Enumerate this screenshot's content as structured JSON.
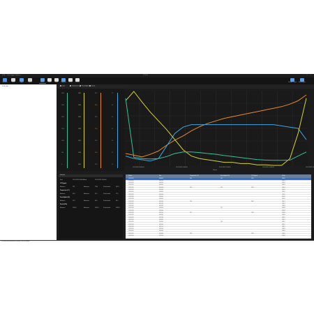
{
  "window": {
    "title": "PCE-... Data Logger Software",
    "center": "PCE-HT",
    "buttons": [
      "–",
      "□",
      "×"
    ]
  },
  "ribbon": {
    "left": [
      {
        "label": "Verbinden",
        "color": "#4a8fe0"
      },
      {
        "label": "Datei",
        "color": "#d8d8d8"
      },
      {
        "label": "Logger",
        "color": "#5aa0e8"
      },
      {
        "label": "Export",
        "color": "#cfcfcf"
      },
      {
        "label": "Ansicht",
        "color": "#5aa0e8",
        "active": true
      },
      {
        "label": "Zoom",
        "color": "#e0e0e0"
      },
      {
        "label": "Farbe",
        "color": "#e0e0e0"
      },
      {
        "label": "Diagramm",
        "color": "#5aa0e8"
      },
      {
        "label": "Tabelle",
        "color": "#e0e0e0"
      },
      {
        "label": "Drucken",
        "color": "#e0e0e0"
      }
    ],
    "right": [
      {
        "label": "Standard Layout",
        "color": "#5aa0e8"
      },
      {
        "label": "Einstellungen",
        "color": "#5aa0e8"
      }
    ]
  },
  "sidebar": {
    "item": "PCE-THD"
  },
  "tabs": [
    "Liste",
    "Temperatur",
    "Feuchtigkeit",
    "Druck"
  ],
  "colors": {
    "temperature": "#e88a2a",
    "humidity": "#3ea6e0",
    "pressure": "#d9d230",
    "dewpoint": "#35c29a",
    "selection": "#2f6fd6"
  },
  "yaxes": [
    {
      "color": "#35c29a",
      "ticks": [
        "3000",
        "2500",
        "2000",
        "1500",
        "1000",
        "500",
        "0"
      ]
    },
    {
      "color": "#d9d230",
      "ticks": [
        "1031",
        "1030",
        "1029",
        "1028",
        "1027",
        "1026",
        "1025"
      ]
    },
    {
      "color": "#e88a2a",
      "ticks": [
        "31,5",
        "30,0",
        "28,5",
        "27,0",
        "25,5",
        "24,0",
        "22,5"
      ]
    },
    {
      "color": "#3ea6e0",
      "ticks": [
        "75",
        "65",
        "55",
        "45",
        "35",
        "25",
        "15"
      ]
    }
  ],
  "chart_data": {
    "type": "line",
    "xlabel": "Datum",
    "x_ticks": [
      "12.05.2021 08:00:00",
      "12.05.2021 10:00:00",
      "12.05.2021 12:00:00",
      "12.05.2021 14:00:00",
      "12.05.2021 16:00:00"
    ],
    "grid": true,
    "series": [
      {
        "color": "#e88a2a",
        "values": [
          24.0,
          23.8,
          23.6,
          23.9,
          24.3,
          25.0,
          25.6,
          26.1,
          26.7,
          27.2,
          27.6,
          27.9,
          28.2,
          28.4,
          28.6,
          28.8,
          29.0,
          29.2,
          29.4,
          29.6,
          29.9,
          30.3,
          31.0
        ]
      },
      {
        "color": "#3ea6e0",
        "values": [
          23,
          21,
          20,
          19,
          21,
          31,
          41,
          46,
          48,
          48,
          48,
          48,
          48,
          48,
          48,
          48,
          48,
          48,
          48,
          47,
          46,
          45,
          36
        ]
      },
      {
        "color": "#d9d230",
        "values": [
          1030.2,
          1031.0,
          1030.1,
          1029.3,
          1028.6,
          1027.9,
          1027.1,
          1026.3,
          1025.8,
          1025.6,
          1025.5,
          1025.4,
          1025.3,
          1025.3,
          1025.2,
          1025.2,
          1025.1,
          1025.1,
          1025.0,
          1025.0,
          1025.6,
          1027.6,
          1030.4
        ]
      },
      {
        "color": "#35c29a",
        "values": [
          2700,
          350,
          300,
          280,
          300,
          380,
          500,
          560,
          560,
          540,
          500,
          470,
          420,
          380,
          340,
          300,
          260,
          240,
          230,
          230,
          240,
          400,
          560
        ]
      }
    ],
    "ranges": [
      [
        22.5,
        31.5
      ],
      [
        15,
        75
      ],
      [
        1025,
        1031
      ],
      [
        0,
        3000
      ]
    ]
  },
  "summary": {
    "header": "Statistik",
    "rows": [
      {
        "a": "Start",
        "b": "12.05.2021 08:00:00",
        "c": "Ende",
        "d": "12.05.2021 16:00:00"
      },
      {
        "title": "CO2 (ppm)"
      },
      {
        "a": "Minimum",
        "b": "225",
        "c": "Maximum",
        "d": "2740",
        "e": "Durchschnitt",
        "f": "612,4"
      },
      {
        "title": "Temperatur (°C)"
      },
      {
        "a": "Minimum",
        "b": "23,4",
        "c": "Maximum",
        "d": "31,2",
        "e": "Durchschnitt",
        "f": "27,5"
      },
      {
        "title": "Feuchtigkeit (%)"
      },
      {
        "a": "Minimum",
        "b": "19,2",
        "c": "Maximum",
        "d": "49,0",
        "e": "Durchschnitt",
        "f": "43,1"
      },
      {
        "title": "Druck (hPa)"
      },
      {
        "a": "Minimum",
        "b": "1025,0",
        "c": "Maximum",
        "d": "1031,0",
        "e": "Durchschnitt",
        "f": "1026,3"
      }
    ]
  },
  "table": {
    "headers": [
      "Datum",
      "Zeit",
      "Temperatur (°C)",
      "Feuchtigkeit (%)",
      "CO2 (ppm)",
      "Druck"
    ],
    "rows": [
      [
        "12.05.2021",
        "08:00:00",
        "24,0",
        "23,1",
        "2700",
        "1030,2"
      ],
      [
        "12.05.2021",
        "08:01:00",
        "",
        "",
        "",
        "1030,2"
      ],
      [
        "12.05.2021",
        "08:02:00",
        "",
        "",
        "",
        "1030,3"
      ],
      [
        "12.05.2021",
        "08:03:00",
        "",
        "",
        "",
        "1030,3"
      ],
      [
        "12.05.2021",
        "08:04:00",
        "23,9",
        "22,8",
        "2410",
        "1030,4"
      ],
      [
        "12.05.2021",
        "08:05:00",
        "",
        "",
        "",
        "1030,4"
      ],
      [
        "12.05.2021",
        "08:06:00",
        "",
        "",
        "",
        "1030,5"
      ],
      [
        "12.05.2021",
        "08:07:00",
        "",
        "",
        "",
        "1030,5"
      ],
      [
        "12.05.2021",
        "08:08:00",
        "",
        "",
        "",
        "1030,6"
      ],
      [
        "12.05.2021",
        "08:09:00",
        "",
        "",
        "",
        "1030,6"
      ],
      [
        "12.05.2021",
        "08:10:00",
        "23,8",
        "",
        "2080",
        "1030,7"
      ],
      [
        "12.05.2021",
        "08:11:00",
        "",
        "",
        "",
        "1030,7"
      ],
      [
        "12.05.2021",
        "08:12:00",
        "",
        "",
        "",
        "1030,8"
      ],
      [
        "12.05.2021",
        "08:13:00",
        "",
        "22,1",
        "",
        "1030,8"
      ],
      [
        "12.05.2021",
        "08:14:00",
        "",
        "",
        "",
        "1030,8"
      ],
      [
        "12.05.2021",
        "08:15:00",
        "23,7",
        "",
        "1740",
        "1030,9"
      ],
      [
        "12.05.2021",
        "08:16:00",
        "",
        "",
        "",
        "1030,9"
      ],
      [
        "12.05.2021",
        "08:17:00",
        "",
        "",
        "",
        "1031,0"
      ],
      [
        "12.05.2021",
        "08:18:00",
        "",
        "",
        "",
        "1031,0"
      ],
      [
        "12.05.2021",
        "08:19:00",
        "",
        "21,6",
        "",
        "1031,0"
      ],
      [
        "12.05.2021",
        "08:20:00",
        "",
        "",
        "",
        "1031,0"
      ],
      [
        "12.05.2021",
        "08:21:00",
        "",
        "",
        "",
        "1031,0"
      ],
      [
        "12.05.2021",
        "08:22:00",
        "",
        "",
        "",
        "1030,9"
      ],
      [
        "12.05.2021",
        "08:23:00",
        "",
        "",
        "",
        "1030,9"
      ],
      [
        "12.05.2021",
        "08:24:00",
        "23,6",
        "",
        "1310",
        "1030,9"
      ],
      [
        "12.05.2021",
        "08:25:00",
        "",
        "",
        "",
        "1030,8"
      ]
    ]
  },
  "status": "C:\\Users\\Public\\Documents\\PCE\\data_12052021.pcedat"
}
